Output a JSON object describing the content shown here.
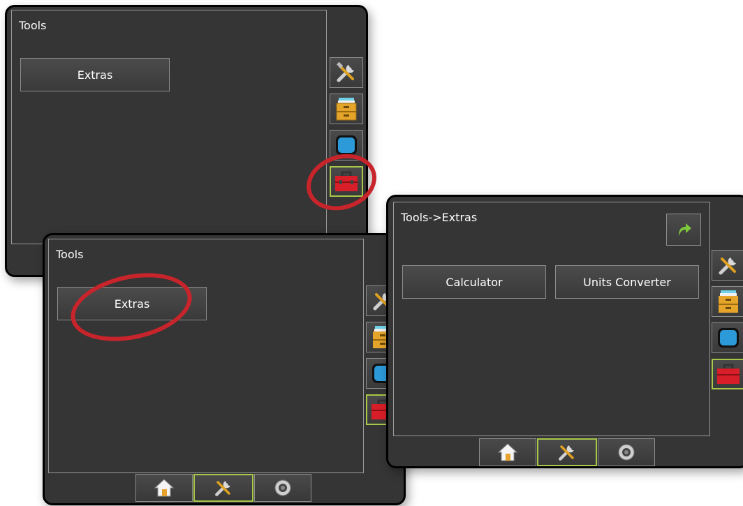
{
  "screen1": {
    "title": "Tools",
    "extras_label": "Extras"
  },
  "screen2": {
    "title": "Tools",
    "extras_label": "Extras"
  },
  "screen3": {
    "title": "Tools->Extras",
    "calculator_label": "Calculator",
    "units_converter_label": "Units Converter"
  },
  "icons": {
    "tools": "tools-icon",
    "data": "file-cabinet-icon",
    "display": "monitor-icon",
    "toolbox": "toolbox-icon",
    "home": "home-icon",
    "camera": "camera-icon",
    "back": "back-arrow-icon"
  },
  "colors": {
    "background": "#353535",
    "highlight": "#c8242b",
    "active_border": "#a8c84a",
    "arrow": "#7ec83c"
  }
}
